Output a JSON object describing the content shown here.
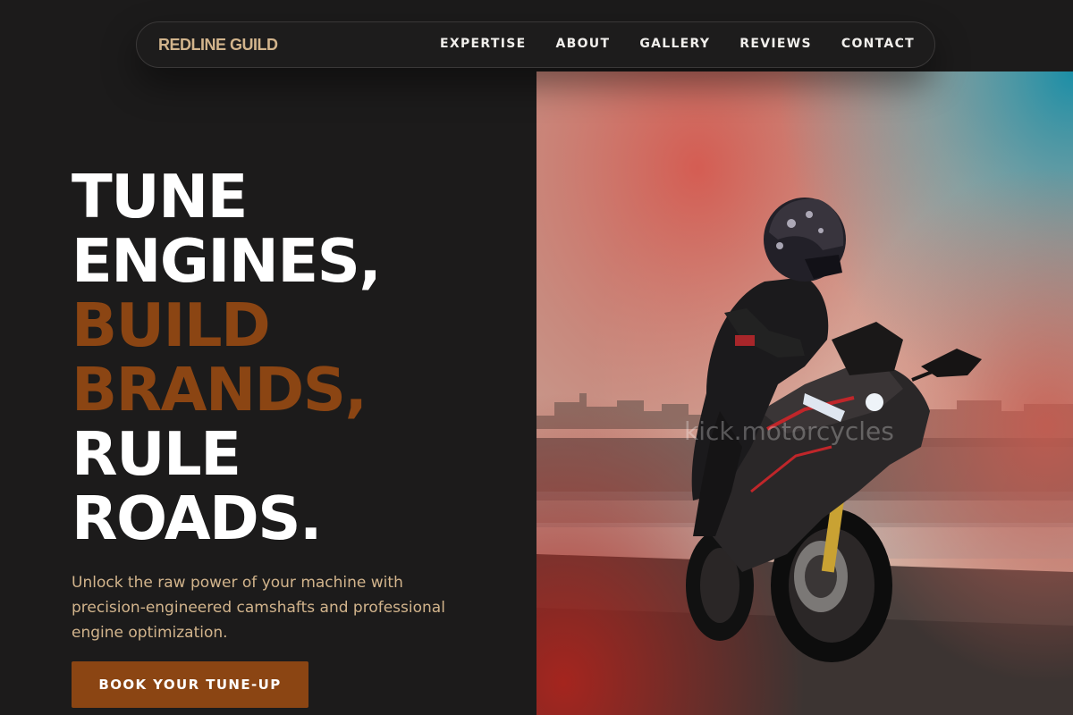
{
  "nav": {
    "brand": "REDLINE GUILD",
    "links": [
      "EXPERTISE",
      "ABOUT",
      "GALLERY",
      "REVIEWS",
      "CONTACT"
    ]
  },
  "hero": {
    "headline_lines": [
      "TUNE",
      "ENGINES,",
      "BUILD",
      "BRANDS,",
      "RULE",
      "ROADS."
    ],
    "description": "Unlock the raw power of your machine with precision-engineered camshafts and professional engine optimization.",
    "cta_label": "BOOK YOUR TUNE-UP",
    "image_watermark": "kick.motorcycles"
  },
  "colors": {
    "background": "#1c1b1b",
    "brand": "#d2b48c",
    "accent": "#8b4513",
    "text": "#ffffff"
  }
}
